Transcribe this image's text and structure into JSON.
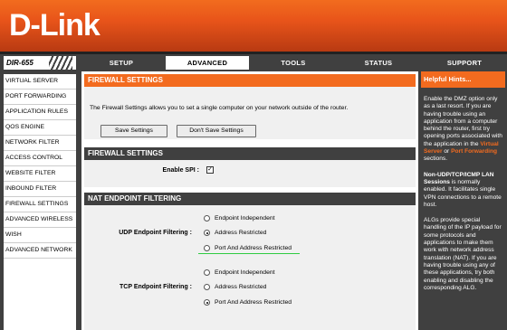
{
  "brand": {
    "logo": "D-Link"
  },
  "model": "DIR-655",
  "tabs": [
    "SETUP",
    "ADVANCED",
    "TOOLS",
    "STATUS",
    "SUPPORT"
  ],
  "sidebar": {
    "items": [
      "VIRTUAL SERVER",
      "PORT FORWARDING",
      "APPLICATION RULES",
      "QOS ENGINE",
      "NETWORK FILTER",
      "ACCESS CONTROL",
      "WEBSITE FILTER",
      "INBOUND FILTER",
      "FIREWALL SETTINGS",
      "ADVANCED WIRELESS",
      "WISH",
      "ADVANCED NETWORK"
    ]
  },
  "firewall": {
    "title": "FIREWALL SETTINGS",
    "description": "The Firewall Settings allows you to set a single computer on your network outside of the router.",
    "save_label": "Save Settings",
    "dont_save_label": "Don't Save Settings"
  },
  "firewall_settings": {
    "title": "FIREWALL SETTINGS",
    "enable_spi_label": "Enable SPI :",
    "enable_spi_checked": "✓"
  },
  "nat": {
    "title": "NAT ENDPOINT FILTERING",
    "udp_label": "UDP Endpoint Filtering :",
    "tcp_label": "TCP Endpoint Filtering :",
    "options": [
      "Endpoint Independent",
      "Address Restricted",
      "Port And Address Restricted"
    ],
    "udp_selected": "Address Restricted",
    "tcp_selected": "Port And Address Restricted"
  },
  "hints": {
    "title": "Helpful Hints...",
    "p1_text": "Enable the DMZ option only as a last resort. If you are having trouble using an application from a computer behind the router, first try opening ports associated with the application in the",
    "p1_link1": "Virtual Server",
    "p1_or": "or",
    "p1_link2": "Port Forwarding",
    "p1_end": "sections.",
    "p2_bold": "Non-UDP/TCP/ICMP LAN Sessions",
    "p2_text": "is normally enabled. It facilitates single VPN connections to a remote host.",
    "p3_text": "ALGs provide special handling of the IP payload for some protocols and applications to make them work with network address translation (NAT). If you are having trouble using any of these applications, try both enabling and disabling the corresponding ALG."
  },
  "colors": {
    "accent": "#f36b1f",
    "dark": "#404040",
    "highlight": "#2ecc40"
  }
}
